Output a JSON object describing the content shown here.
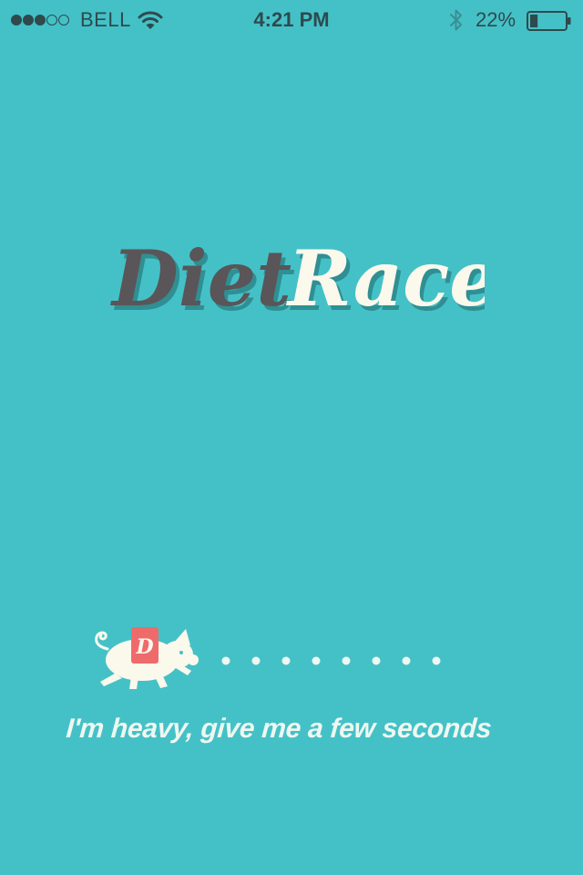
{
  "status_bar": {
    "carrier": "BELL",
    "time": "4:21 PM",
    "battery_percent": "22%",
    "battery_level": 0.22,
    "signal_bars_filled": 3,
    "signal_bars_total": 5,
    "icons": [
      "signal-dots-icon",
      "wifi-icon",
      "bluetooth-icon",
      "battery-icon"
    ]
  },
  "logo": {
    "word_left": "Diet",
    "word_right": "Race",
    "colors": {
      "left": "#5a5558",
      "right": "#fbf8ec",
      "shadow": "#2f8f93"
    }
  },
  "loader": {
    "pig_badge_letter": "D",
    "progress_dot_count": 8,
    "message": "I'm heavy, give me a few seconds"
  },
  "colors": {
    "background": "#44c1c7",
    "pig": "#fbf8ec",
    "badge": "#ef6b6b",
    "status_text": "#2e4a4d"
  }
}
